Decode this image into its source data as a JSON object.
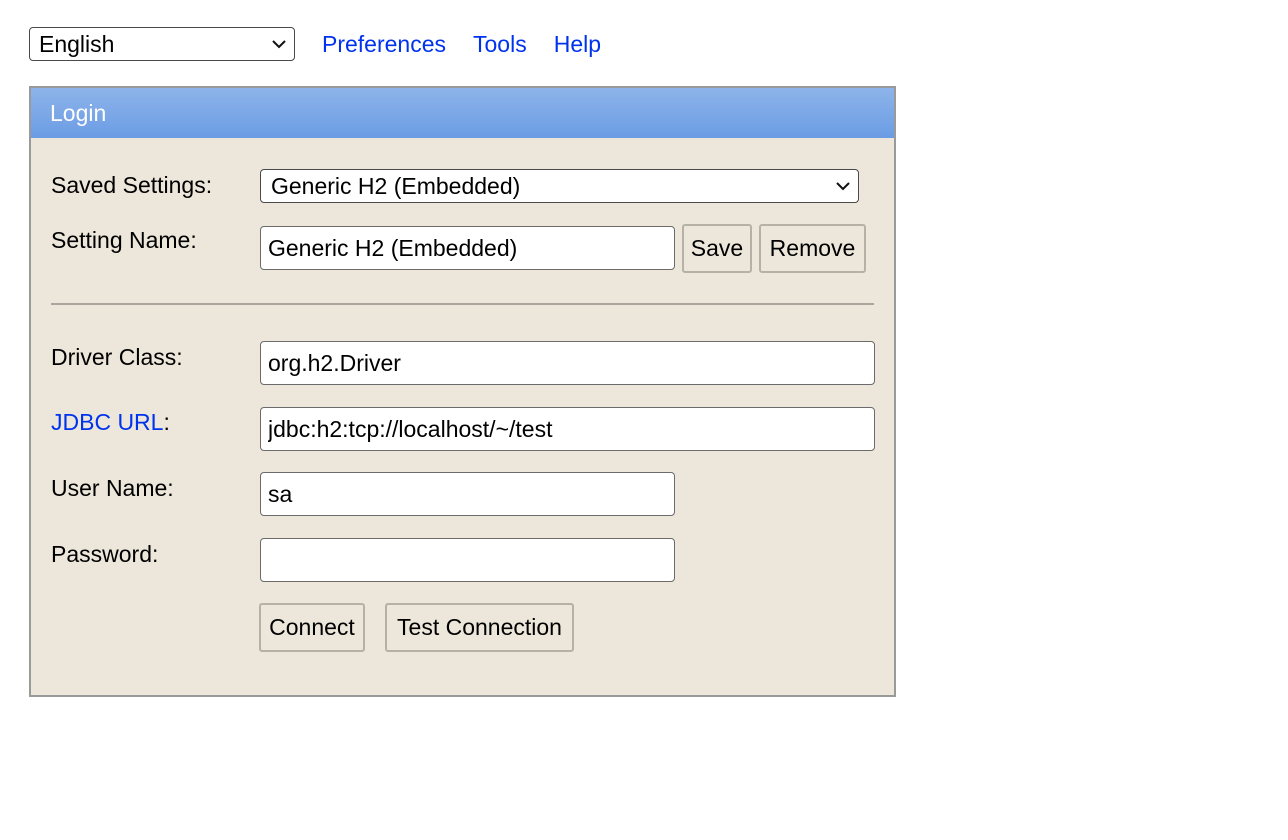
{
  "topbar": {
    "language": "English",
    "links": [
      "Preferences",
      "Tools",
      "Help"
    ]
  },
  "login": {
    "title": "Login",
    "saved_settings_label": "Saved Settings:",
    "saved_settings_value": "Generic H2 (Embedded)",
    "setting_name_label": "Setting Name:",
    "setting_name_value": "Generic H2 (Embedded)",
    "save_label": "Save",
    "remove_label": "Remove",
    "driver_class_label": "Driver Class:",
    "driver_class_value": "org.h2.Driver",
    "jdbc_url_link": "JDBC URL",
    "jdbc_url_colon": ":",
    "jdbc_url_value": "jdbc:h2:tcp://localhost/~/test",
    "user_name_label": "User Name:",
    "user_name_value": "sa",
    "password_label": "Password:",
    "password_value": "",
    "connect_label": "Connect",
    "test_connection_label": "Test Connection"
  },
  "colors": {
    "link": "#0033ee",
    "header_gradient_top": "#8db4ea",
    "header_gradient_bottom": "#6b9ce4",
    "panel_bg": "#ece7da"
  },
  "icons": {
    "dropdown": "chevron-down-icon"
  }
}
